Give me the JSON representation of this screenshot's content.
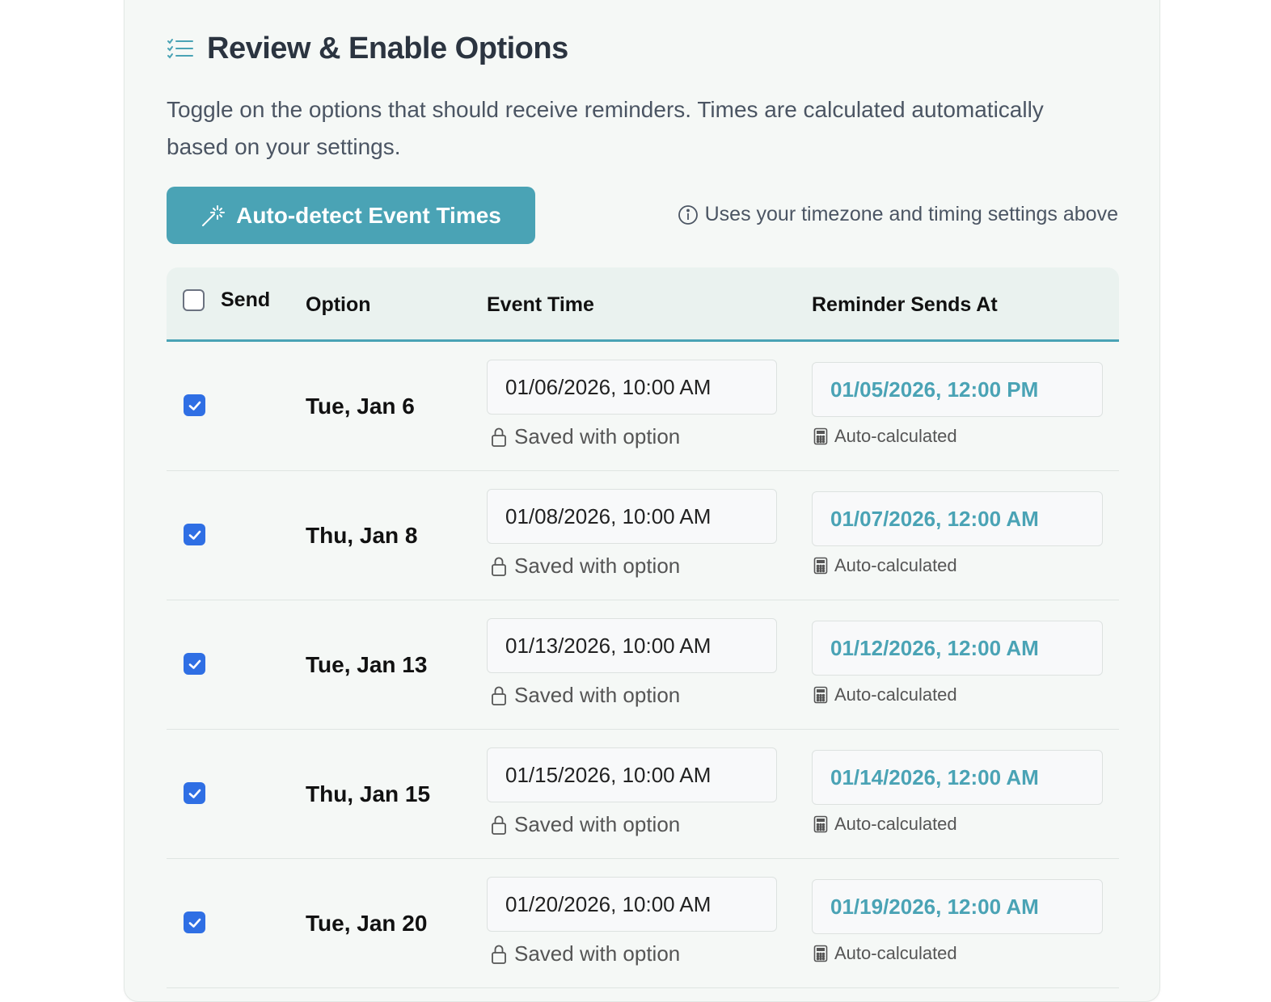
{
  "panel": {
    "title": "Review & Enable Options",
    "description": "Toggle on the options that should receive reminders. Times are calculated automatically based on your settings.",
    "auto_detect_label": "Auto-detect Event Times",
    "hint": "Uses your timezone and timing settings above",
    "icons": {
      "title": "checklist-icon",
      "button": "magic-wand-icon",
      "hint": "info-icon",
      "saved": "lock-icon",
      "auto": "calculator-icon"
    },
    "colors": {
      "accent": "#4aa3b5",
      "checkbox": "#2f6fe4"
    }
  },
  "table": {
    "columns": {
      "send": "Send",
      "option": "Option",
      "event_time": "Event Time",
      "reminder": "Reminder Sends At"
    },
    "select_all_checked": false,
    "rows": [
      {
        "checked": true,
        "option": "Tue, Jan 6",
        "event_time": "01/06/2026, 10:00 AM",
        "event_note": "Saved with option",
        "reminder": "01/05/2026, 12:00 PM",
        "reminder_note": "Auto-calculated"
      },
      {
        "checked": true,
        "option": "Thu, Jan 8",
        "event_time": "01/08/2026, 10:00 AM",
        "event_note": "Saved with option",
        "reminder": "01/07/2026, 12:00 AM",
        "reminder_note": "Auto-calculated"
      },
      {
        "checked": true,
        "option": "Tue, Jan 13",
        "event_time": "01/13/2026, 10:00 AM",
        "event_note": "Saved with option",
        "reminder": "01/12/2026, 12:00 AM",
        "reminder_note": "Auto-calculated"
      },
      {
        "checked": true,
        "option": "Thu, Jan 15",
        "event_time": "01/15/2026, 10:00 AM",
        "event_note": "Saved with option",
        "reminder": "01/14/2026, 12:00 AM",
        "reminder_note": "Auto-calculated"
      },
      {
        "checked": true,
        "option": "Tue, Jan 20",
        "event_time": "01/20/2026, 10:00 AM",
        "event_note": "Saved with option",
        "reminder": "01/19/2026, 12:00 AM",
        "reminder_note": "Auto-calculated"
      }
    ]
  }
}
